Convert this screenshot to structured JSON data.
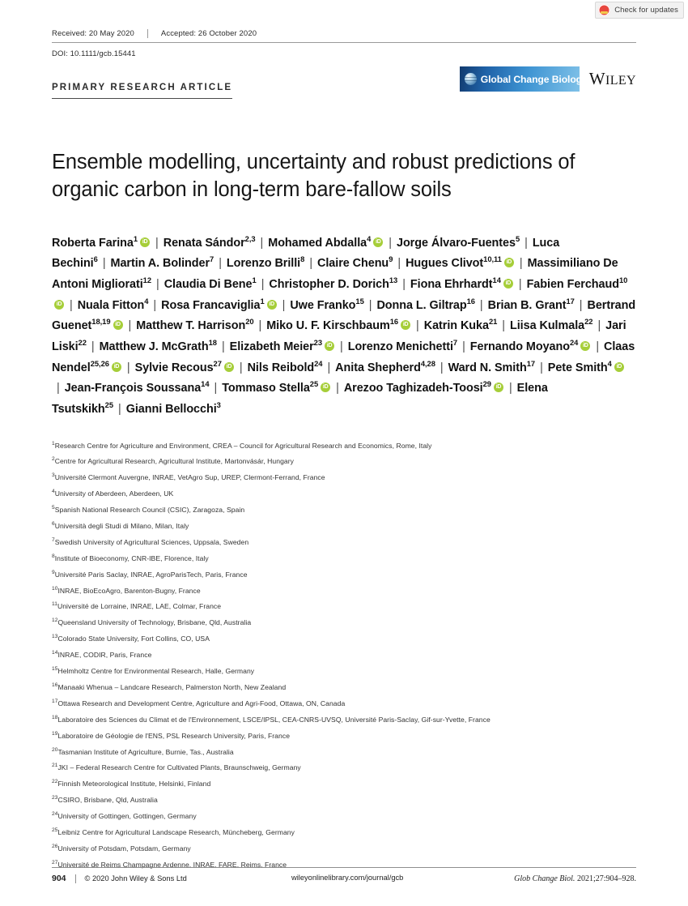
{
  "badge": {
    "label": "Check for updates",
    "icon": "crossmark-icon"
  },
  "header": {
    "received": "Received: 20 May 2020",
    "accepted": "Accepted: 26 October 2020",
    "doi": "DOI: 10.1111/gcb.15441",
    "article_type": "PRIMARY RESEARCH ARTICLE",
    "journal_logo_text": "Global Change Biology",
    "publisher_logo_text": "WILEY",
    "publisher_logo_lead": "W",
    "publisher_logo_rest": "ILEY"
  },
  "title": "Ensemble modelling, uncertainty and robust predictions of organic carbon in long-term bare-fallow soils",
  "authors": [
    {
      "name": "Roberta Farina",
      "sup": "1",
      "orcid": true
    },
    {
      "name": "Renata Sándor",
      "sup": "2,3",
      "orcid": false
    },
    {
      "name": "Mohamed Abdalla",
      "sup": "4",
      "orcid": true
    },
    {
      "name": "Jorge Álvaro-Fuentes",
      "sup": "5",
      "orcid": false
    },
    {
      "name": "Luca Bechini",
      "sup": "6",
      "orcid": false
    },
    {
      "name": "Martin A. Bolinder",
      "sup": "7",
      "orcid": false
    },
    {
      "name": "Lorenzo Brilli",
      "sup": "8",
      "orcid": false
    },
    {
      "name": "Claire Chenu",
      "sup": "9",
      "orcid": false
    },
    {
      "name": "Hugues Clivot",
      "sup": "10,11",
      "orcid": true
    },
    {
      "name": "Massimiliano De Antoni Migliorati",
      "sup": "12",
      "orcid": false
    },
    {
      "name": "Claudia Di Bene",
      "sup": "1",
      "orcid": false
    },
    {
      "name": "Christopher D. Dorich",
      "sup": "13",
      "orcid": false
    },
    {
      "name": "Fiona Ehrhardt",
      "sup": "14",
      "orcid": true
    },
    {
      "name": "Fabien Ferchaud",
      "sup": "10",
      "orcid": true
    },
    {
      "name": "Nuala Fitton",
      "sup": "4",
      "orcid": false
    },
    {
      "name": "Rosa Francaviglia",
      "sup": "1",
      "orcid": true
    },
    {
      "name": "Uwe Franko",
      "sup": "15",
      "orcid": false
    },
    {
      "name": "Donna L. Giltrap",
      "sup": "16",
      "orcid": false
    },
    {
      "name": "Brian B. Grant",
      "sup": "17",
      "orcid": false
    },
    {
      "name": "Bertrand Guenet",
      "sup": "18,19",
      "orcid": true
    },
    {
      "name": "Matthew T. Harrison",
      "sup": "20",
      "orcid": false
    },
    {
      "name": "Miko U. F. Kirschbaum",
      "sup": "16",
      "orcid": true
    },
    {
      "name": "Katrin Kuka",
      "sup": "21",
      "orcid": false
    },
    {
      "name": "Liisa Kulmala",
      "sup": "22",
      "orcid": false
    },
    {
      "name": "Jari Liski",
      "sup": "22",
      "orcid": false
    },
    {
      "name": "Matthew J. McGrath",
      "sup": "18",
      "orcid": false
    },
    {
      "name": "Elizabeth Meier",
      "sup": "23",
      "orcid": true
    },
    {
      "name": "Lorenzo Menichetti",
      "sup": "7",
      "orcid": false
    },
    {
      "name": "Fernando Moyano",
      "sup": "24",
      "orcid": true
    },
    {
      "name": "Claas Nendel",
      "sup": "25,26",
      "orcid": true
    },
    {
      "name": "Sylvie Recous",
      "sup": "27",
      "orcid": true
    },
    {
      "name": "Nils Reibold",
      "sup": "24",
      "orcid": false
    },
    {
      "name": "Anita Shepherd",
      "sup": "4,28",
      "orcid": false
    },
    {
      "name": "Ward N. Smith",
      "sup": "17",
      "orcid": false
    },
    {
      "name": "Pete Smith",
      "sup": "4",
      "orcid": true
    },
    {
      "name": "Jean-François Soussana",
      "sup": "14",
      "orcid": false
    },
    {
      "name": "Tommaso Stella",
      "sup": "25",
      "orcid": true
    },
    {
      "name": "Arezoo Taghizadeh-Toosi",
      "sup": "29",
      "orcid": true
    },
    {
      "name": "Elena Tsutskikh",
      "sup": "25",
      "orcid": false
    },
    {
      "name": "Gianni Bellocchi",
      "sup": "3",
      "orcid": false
    }
  ],
  "author_separator": "|",
  "affiliations": [
    {
      "sup": "1",
      "text": "Research Centre for Agriculture and Environment, CREA – Council for Agricultural Research and Economics, Rome, Italy"
    },
    {
      "sup": "2",
      "text": "Centre for Agricultural Research, Agricultural Institute, Martonvásár, Hungary"
    },
    {
      "sup": "3",
      "text": "Université Clermont Auvergne, INRAE, VetAgro Sup, UREP, Clermont-Ferrand, France"
    },
    {
      "sup": "4",
      "text": "University of Aberdeen, Aberdeen, UK"
    },
    {
      "sup": "5",
      "text": "Spanish National Research Council (CSIC), Zaragoza, Spain"
    },
    {
      "sup": "6",
      "text": "Università degli Studi di Milano, Milan, Italy"
    },
    {
      "sup": "7",
      "text": "Swedish University of Agricultural Sciences, Uppsala, Sweden"
    },
    {
      "sup": "8",
      "text": "Institute of Bioeconomy, CNR-IBE, Florence, Italy"
    },
    {
      "sup": "9",
      "text": "Université Paris Saclay, INRAE, AgroParisTech, Paris, France"
    },
    {
      "sup": "10",
      "text": "INRAE, BioEcoAgro, Barenton-Bugny, France"
    },
    {
      "sup": "11",
      "text": "Université de Lorraine, INRAE, LAE, Colmar, France"
    },
    {
      "sup": "12",
      "text": "Queensland University of Technology, Brisbane, Qld, Australia"
    },
    {
      "sup": "13",
      "text": "Colorado State University, Fort Collins, CO, USA"
    },
    {
      "sup": "14",
      "text": "INRAE, CODIR, Paris, France"
    },
    {
      "sup": "15",
      "text": "Helmholtz Centre for Environmental Research, Halle, Germany"
    },
    {
      "sup": "16",
      "text": "Manaaki Whenua – Landcare Research, Palmerston North, New Zealand"
    },
    {
      "sup": "17",
      "text": "Ottawa Research and Development Centre, Agriculture and Agri-Food, Ottawa, ON, Canada"
    },
    {
      "sup": "18",
      "text": "Laboratoire des Sciences du Climat et de l'Environnement, LSCE/IPSL, CEA-CNRS-UVSQ, Université Paris-Saclay, Gif-sur-Yvette, France"
    },
    {
      "sup": "19",
      "text": "Laboratoire de Géologie de l'ENS, PSL Research University, Paris, France"
    },
    {
      "sup": "20",
      "text": "Tasmanian Institute of Agriculture, Burnie, Tas., Australia"
    },
    {
      "sup": "21",
      "text": "JKI – Federal Research Centre for Cultivated Plants, Braunschweig, Germany"
    },
    {
      "sup": "22",
      "text": "Finnish Meteorological Institute, Helsinki, Finland"
    },
    {
      "sup": "23",
      "text": "CSIRO, Brisbane, Qld, Australia"
    },
    {
      "sup": "24",
      "text": "University of Gottingen, Gottingen, Germany"
    },
    {
      "sup": "25",
      "text": "Leibniz Centre for Agricultural Landscape Research, Müncheberg, Germany"
    },
    {
      "sup": "26",
      "text": "University of Potsdam, Potsdam, Germany"
    },
    {
      "sup": "27",
      "text": "Université de Reims Champagne Ardenne, INRAE, FARE, Reims, France"
    }
  ],
  "footer": {
    "page_number": "904",
    "copyright": "© 2020 John Wiley & Sons Ltd",
    "url": "wileyonlinelibrary.com/journal/gcb",
    "citation_italic": "Glob Change Biol.",
    "citation_roman": "2021;27:904–928."
  },
  "colors": {
    "orcid_green": "#a6ce39",
    "journal_blue_dark": "#123a6e",
    "journal_blue_light": "#7fc1e8",
    "crossmark_red": "#e8473f"
  }
}
